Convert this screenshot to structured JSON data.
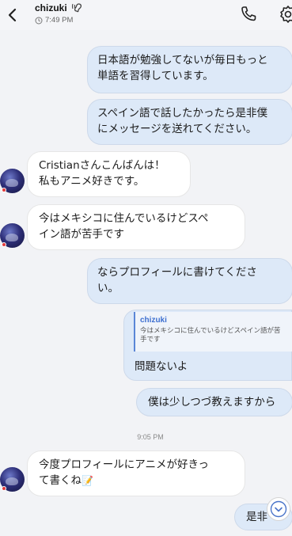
{
  "header": {
    "contact_name": "chizuki",
    "last_seen": "7:49 PM"
  },
  "messages": {
    "m1": "日本語が勉強してないが毎日もっと\n単語を習得しています。",
    "m2": "スペイン語で話したかったら是非僕\nにメッセージを送れてください。",
    "m3": "Cristianさんこんばんは！\n私もアニメ好きです。",
    "m4": "今はメキシコに住んでいるけどスペ\nイン語が苦手です",
    "m5": "ならプロフィールに書けてくださ\nい。",
    "m6_quote_name": "chizuki",
    "m6_quote_text": "今はメキシコに住んでいるけどスペイン語が苦\n手です",
    "m6": "問題ないよ",
    "m7": "僕は少しつづ教えますから",
    "timestamp": "9:05 PM",
    "m8": "今度プロフィールにアニメが好きっ\nて書くね",
    "m8_emoji": "📝",
    "m9": "是非"
  },
  "colors": {
    "outgoing_bubble": "#dde9f8",
    "incoming_bubble": "#ffffff",
    "accent": "#3d6fd0"
  }
}
